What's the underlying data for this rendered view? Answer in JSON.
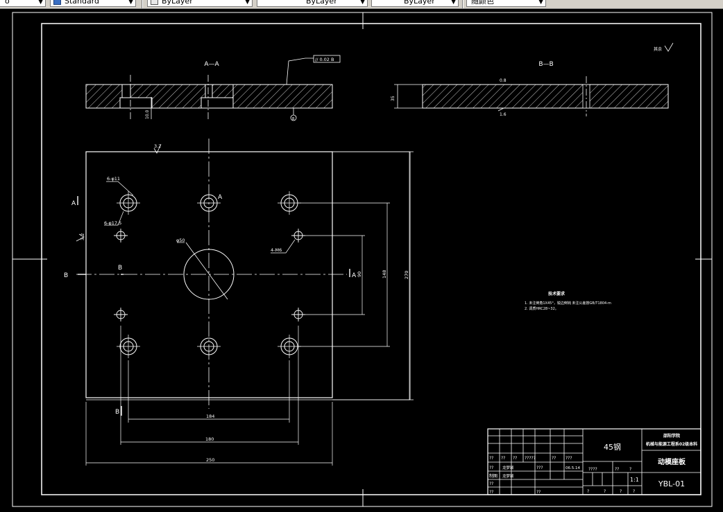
{
  "toolbar": {
    "text_style_partial": "o",
    "dim_style": "Standard",
    "color": "ByLayer",
    "linetype": "ByLayer",
    "lineweight": "ByLayer",
    "plot_style": "随颜色"
  },
  "drawing": {
    "section_aa": "A—A",
    "section_bb": "B—B",
    "roughness_global": "其余",
    "parallel_callout": "// 0.02 B",
    "datum_b": "B",
    "dim_sec_b_thick": "35",
    "dim_sec_b_top": "0.8",
    "dim_sec_b_bottom": "1.6",
    "dim_sec_a_depth": "10.0",
    "label_a_top": "A",
    "label_a_bottom": "A",
    "label_a_mid": "A",
    "label_b_left": "B",
    "label_b_bottom": "B",
    "label_b_center": "B",
    "callout_6_phi11": "6-φ11",
    "callout_6_phi17": "6-φ17.5",
    "callout_4_m": "4-M6",
    "callout_phi50": "φ50",
    "roughness_top": "3.2",
    "roughness_side": "3.2",
    "dim_184": "184",
    "dim_180": "180",
    "dim_250": "250",
    "dim_90": "90",
    "dim_148": "148",
    "dim_270": "270",
    "tech_title": "技术要求",
    "tech_line1": "1. 未注倒角1X45°，锐边倒钝 未注公差按GB/T1804-m",
    "tech_line2": "2. 调质HRC28~32。"
  },
  "title_block": {
    "material": "45钢",
    "school_line1": "邵阳学院",
    "school_line2": "机械与能源工程系02级本科",
    "part_name": "动模座板",
    "drawing_no": "YBL-01",
    "scale": "1:1",
    "date": "06.5.14",
    "design_label": "制图",
    "design_name": "龙梦颖",
    "review_name": "龙梦颖",
    "q2": "??",
    "q3": "???",
    "q4": "????",
    "q5": "?????",
    "q1": "?"
  }
}
